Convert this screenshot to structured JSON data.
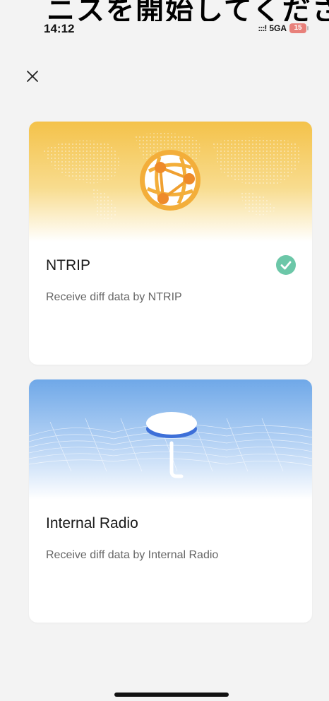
{
  "banner_text": "ニスを開始してください",
  "status": {
    "time": "14:12",
    "signal": ":::!",
    "network": "5GA",
    "battery": "15"
  },
  "cards": [
    {
      "title": "NTRIP",
      "description": "Receive diff data by NTRIP",
      "selected": true,
      "icon": "network-globe-icon"
    },
    {
      "title": "Internal Radio",
      "description": "Receive diff data by Internal Radio",
      "selected": false,
      "icon": "radio-antenna-icon"
    }
  ],
  "colors": {
    "check": "#6cc7a8",
    "ntrip_gradient_top": "#f4c24a",
    "radio_gradient_top": "#6fa8e8"
  }
}
